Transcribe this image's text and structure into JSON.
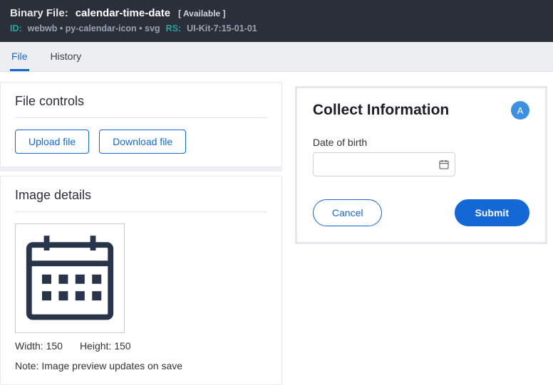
{
  "header": {
    "prefix": "Binary File:",
    "name": "calendar-time-date",
    "status": "[ Available ]",
    "id_label": "ID:",
    "id_value": "webwb • py-calendar-icon • svg",
    "rs_label": "RS:",
    "rs_value": "UI-Kit-7:15-01-01"
  },
  "tabs": {
    "file": "File",
    "history": "History"
  },
  "fileControls": {
    "title": "File controls",
    "upload": "Upload file",
    "download": "Download file"
  },
  "imageDetails": {
    "title": "Image details",
    "widthLabel": "Width:",
    "widthValue": "150",
    "heightLabel": "Height:",
    "heightValue": "150",
    "note": "Note: Image preview updates on save"
  },
  "rightPanel": {
    "title": "Collect Information",
    "avatar": "A",
    "dobLabel": "Date of birth",
    "dobValue": "",
    "cancel": "Cancel",
    "submit": "Submit"
  }
}
